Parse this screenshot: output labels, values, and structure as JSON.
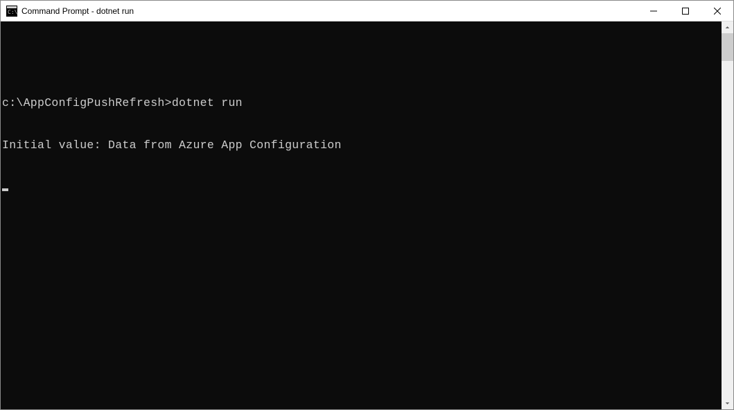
{
  "window": {
    "title": "Command Prompt - dotnet  run"
  },
  "terminal": {
    "prompt_path": "c:\\AppConfigPushRefresh",
    "prompt_char": ">",
    "command": "dotnet run",
    "output_lines": [
      "Initial value: Data from Azure App Configuration"
    ]
  },
  "icons": {
    "app_icon": "cmd-icon",
    "minimize": "minimize-icon",
    "maximize": "maximize-icon",
    "close": "close-icon",
    "scroll_up": "chevron-up-icon",
    "scroll_down": "chevron-down-icon"
  }
}
